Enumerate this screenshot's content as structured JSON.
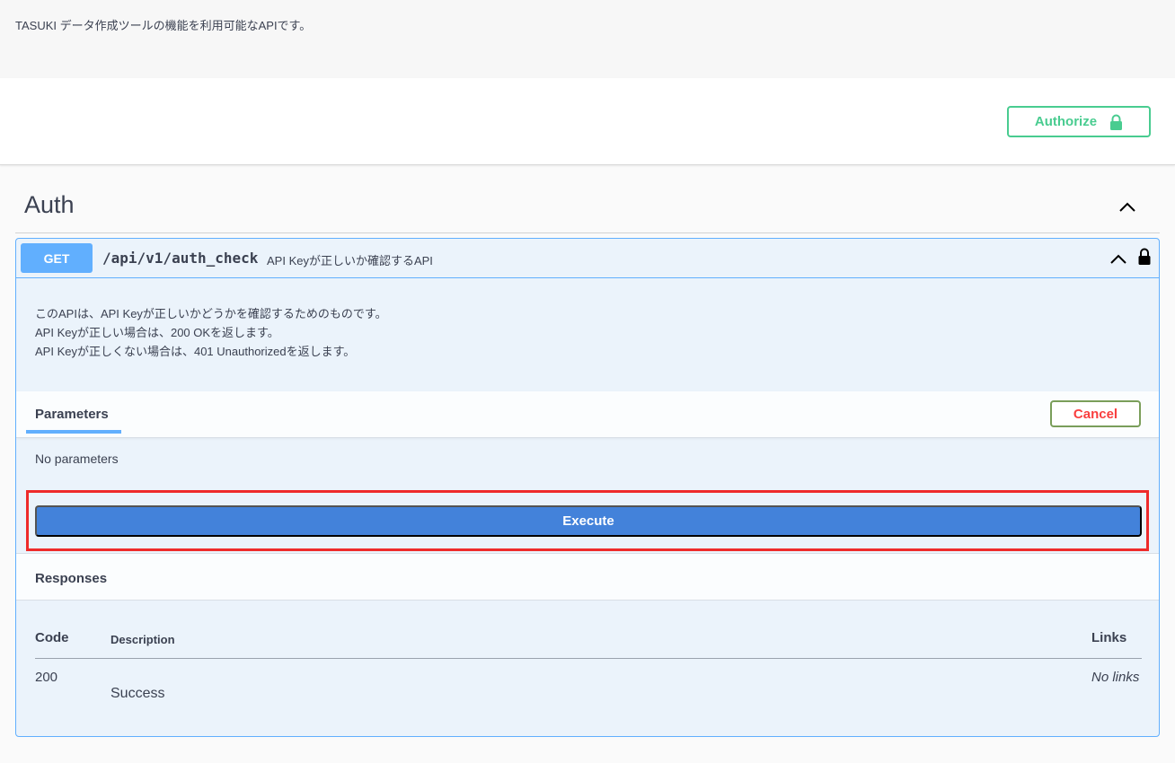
{
  "info": {
    "description": "TASUKI データ作成ツールの機能を利用可能なAPIです。"
  },
  "auth": {
    "authorize_label": "Authorize"
  },
  "tag": {
    "title": "Auth"
  },
  "operation": {
    "method": "GET",
    "path": "/api/v1/auth_check",
    "summary": "API Keyが正しいか確認するAPI",
    "description_lines": [
      "このAPIは、API Keyが正しいかどうかを確認するためのものです。",
      "API Keyが正しい場合は、200 OKを返します。",
      "API Keyが正しくない場合は、401 Unauthorizedを返します。"
    ],
    "parameters_tab": "Parameters",
    "cancel_label": "Cancel",
    "no_parameters": "No parameters",
    "execute_label": "Execute",
    "responses_title": "Responses",
    "responses_table": {
      "headers": {
        "code": "Code",
        "description": "Description",
        "links": "Links"
      },
      "rows": [
        {
          "code": "200",
          "description": "Success",
          "links": "No links"
        }
      ]
    }
  },
  "colors": {
    "get_method": "#61affe",
    "authorize_green": "#49cc90",
    "execute_blue": "#4382da",
    "cancel_red": "#f93e3e",
    "highlight_red": "#ee2b2b"
  },
  "icons": {
    "authorize": "lock-icon",
    "tag_toggle": "chevron-up-icon",
    "operation_toggle": "chevron-up-icon",
    "operation_auth": "lock-icon"
  }
}
